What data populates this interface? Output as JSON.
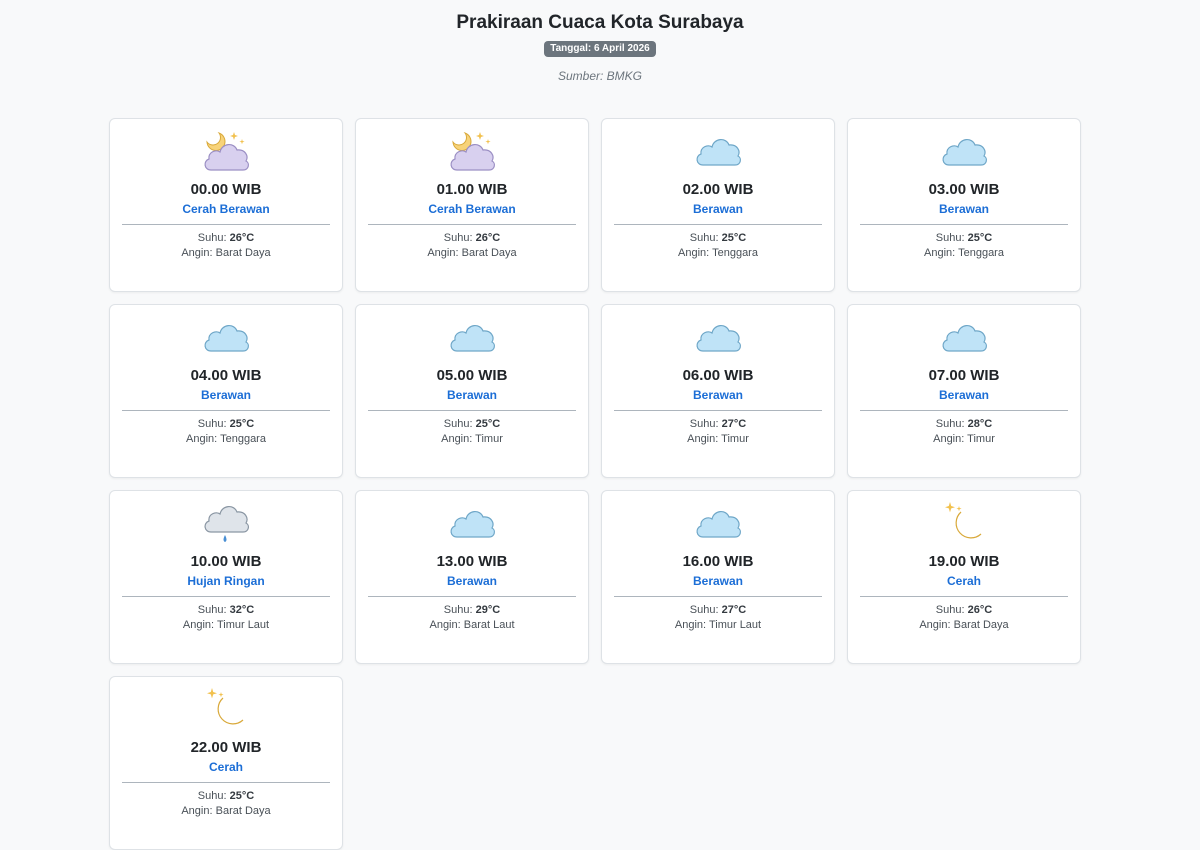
{
  "page": {
    "title": "Prakiraan Cuaca Kota Surabaya",
    "date_label": "Tanggal: 6 April 2026",
    "source": "Sumber: BMKG"
  },
  "labels": {
    "temp_prefix": "Suhu:",
    "wind_prefix": "Angin:"
  },
  "colors": {
    "condition_text": "#1c6ed6",
    "badge_bg": "#6c757d"
  },
  "forecasts": [
    {
      "time": "00.00 WIB",
      "condition": "Cerah Berawan",
      "temp": "26°C",
      "wind": "Barat Daya",
      "icon": "moon-cloud-icon"
    },
    {
      "time": "01.00 WIB",
      "condition": "Cerah Berawan",
      "temp": "26°C",
      "wind": "Barat Daya",
      "icon": "moon-cloud-icon"
    },
    {
      "time": "02.00 WIB",
      "condition": "Berawan",
      "temp": "25°C",
      "wind": "Tenggara",
      "icon": "cloud-icon"
    },
    {
      "time": "03.00 WIB",
      "condition": "Berawan",
      "temp": "25°C",
      "wind": "Tenggara",
      "icon": "cloud-icon"
    },
    {
      "time": "04.00 WIB",
      "condition": "Berawan",
      "temp": "25°C",
      "wind": "Tenggara",
      "icon": "cloud-icon"
    },
    {
      "time": "05.00 WIB",
      "condition": "Berawan",
      "temp": "25°C",
      "wind": "Timur",
      "icon": "cloud-icon"
    },
    {
      "time": "06.00 WIB",
      "condition": "Berawan",
      "temp": "27°C",
      "wind": "Timur",
      "icon": "cloud-icon"
    },
    {
      "time": "07.00 WIB",
      "condition": "Berawan",
      "temp": "28°C",
      "wind": "Timur",
      "icon": "cloud-icon"
    },
    {
      "time": "10.00 WIB",
      "condition": "Hujan Ringan",
      "temp": "32°C",
      "wind": "Timur Laut",
      "icon": "rain-cloud-icon"
    },
    {
      "time": "13.00 WIB",
      "condition": "Berawan",
      "temp": "29°C",
      "wind": "Barat Laut",
      "icon": "cloud-icon"
    },
    {
      "time": "16.00 WIB",
      "condition": "Berawan",
      "temp": "27°C",
      "wind": "Timur Laut",
      "icon": "cloud-icon"
    },
    {
      "time": "19.00 WIB",
      "condition": "Cerah",
      "temp": "26°C",
      "wind": "Barat Daya",
      "icon": "moon-icon"
    },
    {
      "time": "22.00 WIB",
      "condition": "Cerah",
      "temp": "25°C",
      "wind": "Barat Daya",
      "icon": "moon-icon"
    }
  ]
}
